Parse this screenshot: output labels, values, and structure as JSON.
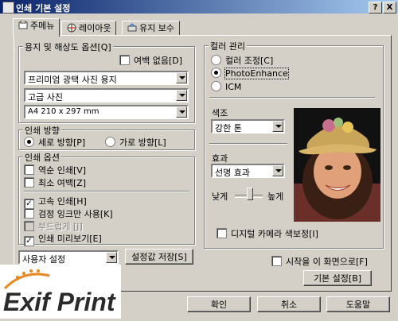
{
  "window": {
    "title": "인쇄 기본 설정",
    "help_button": "?",
    "close_button": "X"
  },
  "tabs": [
    {
      "label": "주메뉴",
      "icon": "main-menu-icon"
    },
    {
      "label": "레이아웃",
      "icon": "layout-icon"
    },
    {
      "label": "유지 보수",
      "icon": "maintenance-icon"
    }
  ],
  "paper": {
    "group_label": "용지 및 해상도 옵션[Q]",
    "borderless_label": "여백 없음[D]",
    "borderless_checked": false,
    "media_type": "프리미엄 광택 사진 용지",
    "quality": "고급 사진",
    "size": "A4 210 x 297 mm"
  },
  "orientation": {
    "group_label": "인쇄 방향",
    "portrait_label": "세로 방향[P]",
    "landscape_label": "가로 방향[L]",
    "selected": "portrait"
  },
  "print_options": {
    "group_label": "인쇄 옵션",
    "items": [
      {
        "label": "역순 인쇄[V]",
        "checked": false,
        "enabled": true
      },
      {
        "label": "최소 여백[Z]",
        "checked": false,
        "enabled": true
      },
      {
        "label": "고속 인쇄[H]",
        "checked": true,
        "enabled": true
      },
      {
        "label": "검정 잉크만 사용[K]",
        "checked": false,
        "enabled": true
      },
      {
        "label": "부드럽게 [J]",
        "checked": false,
        "enabled": false
      },
      {
        "label": "인쇄 미리보기[E]",
        "checked": true,
        "enabled": true
      }
    ]
  },
  "preset": {
    "value": "사용자 설정",
    "save_button": "설정값 저장[S]"
  },
  "color": {
    "group_label": "컬러 관리",
    "options": [
      {
        "label": "컬러 조정[C]",
        "selected": false
      },
      {
        "label": "PhotoEnhance",
        "selected": true
      },
      {
        "label": "ICM",
        "selected": false
      }
    ],
    "tone_label": "색조",
    "tone_value": "강한 톤",
    "effect_label": "효과",
    "effect_value": "선명 효과",
    "sharp_low": "낮게",
    "sharp_high": "높게",
    "digital_camera_label": "디지털 카메라 색보정[I]",
    "digital_camera_checked": false
  },
  "startup": {
    "label": "시작을 이 화면으로[F]",
    "checked": false
  },
  "buttons": {
    "defaults": "기본 설정[B]",
    "ok": "확인",
    "cancel": "취소",
    "help": "도움말"
  },
  "logo": {
    "text": "Exif Print",
    "colors": {
      "text": "#2a2a2a",
      "accent": "#e8871e"
    }
  }
}
